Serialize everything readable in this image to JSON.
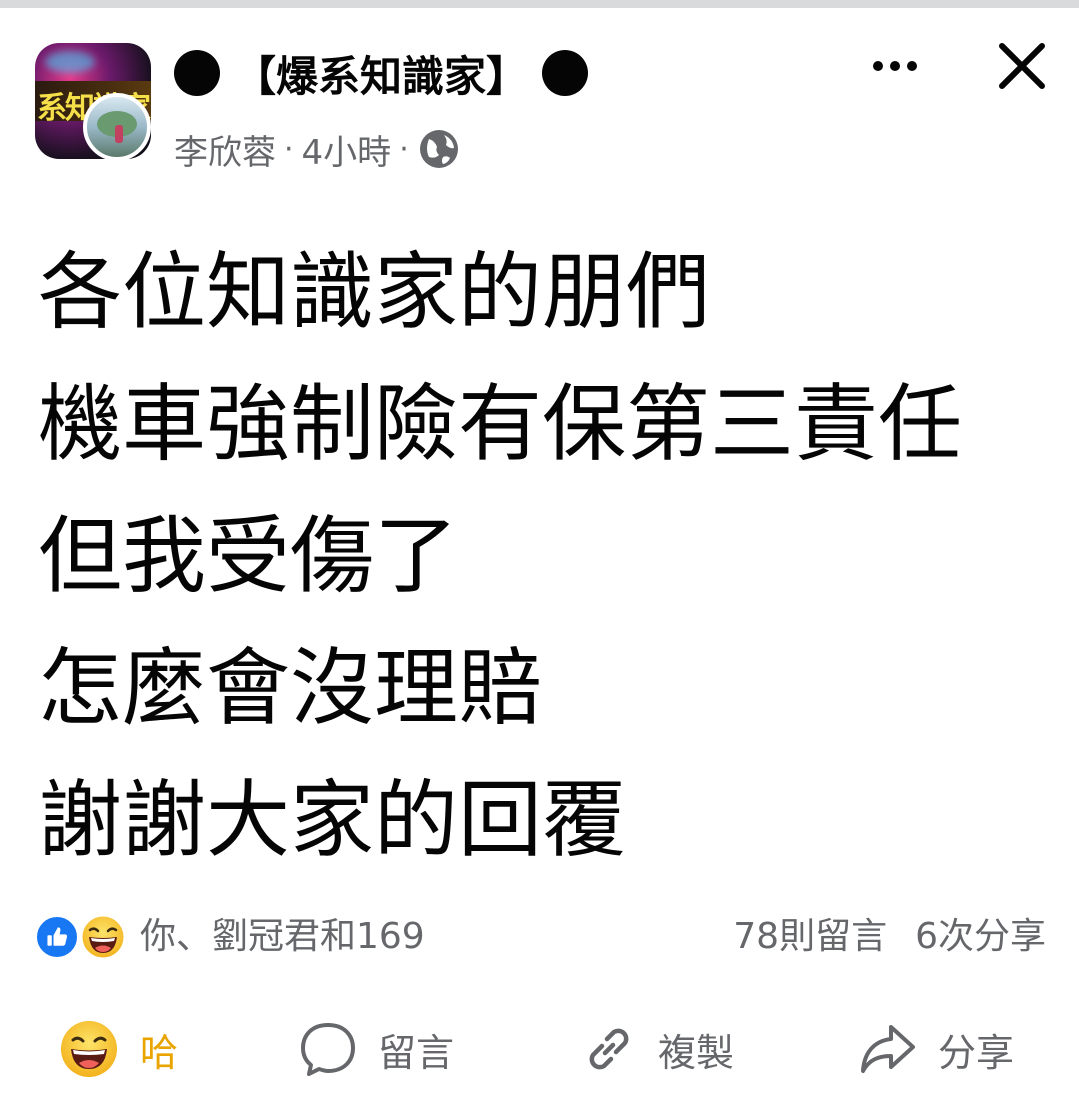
{
  "post": {
    "group_name": "【爆系知識家】",
    "group_avatar_text": "系知識家",
    "author": "李欣蓉",
    "time": "4小時",
    "separator": "·",
    "privacy_icon": "globe-icon",
    "text_lines": [
      "各位知識家的朋們",
      "機車強制險有保第三責任",
      "但我受傷了",
      "怎麼會沒理賠",
      "謝謝大家的回覆"
    ]
  },
  "reactions": {
    "icons": [
      "like-icon",
      "haha-icon"
    ],
    "summary": "你、劉冠君和169",
    "comments": "78則留言",
    "shares": "6次分享"
  },
  "actions": {
    "haha_label": "哈",
    "comment_label": "留言",
    "copy_label": "複製",
    "share_label": "分享"
  },
  "colors": {
    "text": "#050505",
    "secondary": "#65676b",
    "like_blue": "#1877f2",
    "haha_yellow": "#f7c928",
    "haha_active": "#e9a400"
  }
}
